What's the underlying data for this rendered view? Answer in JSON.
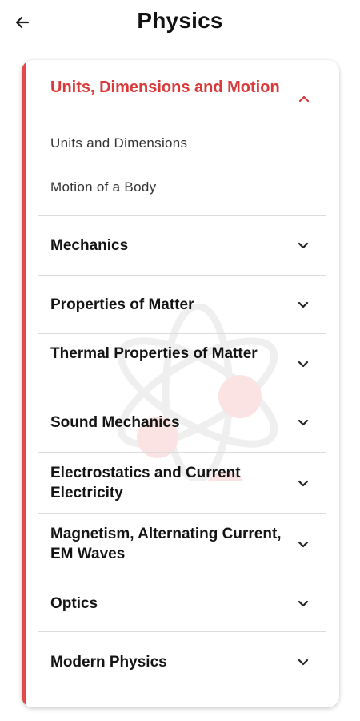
{
  "header": {
    "title": "Physics",
    "back_icon": "arrow-left-icon"
  },
  "colors": {
    "accent": "#d93a3a",
    "accent_bar": "#e24a4a",
    "divider": "#dcdcdc"
  },
  "expanded_section": {
    "title": "Units, Dimensions and Motion",
    "icon": "chevron-up-icon",
    "subitems": [
      "Units and Dimensions",
      "Motion of a Body"
    ]
  },
  "sections": [
    {
      "label": "Mechanics",
      "icon": "chevron-down-icon"
    },
    {
      "label": "Properties of Matter",
      "icon": "chevron-down-icon"
    },
    {
      "label": "Thermal Properties of Matter",
      "icon": "chevron-down-icon"
    },
    {
      "label": "Sound Mechanics",
      "icon": "chevron-down-icon"
    },
    {
      "label": "Electrostatics and Current Electricity",
      "icon": "chevron-down-icon"
    },
    {
      "label": "Magnetism, Alternating Current, EM Waves",
      "icon": "chevron-down-icon"
    },
    {
      "label": "Optics",
      "icon": "chevron-down-icon"
    },
    {
      "label": "Modern Physics",
      "icon": "chevron-down-icon"
    }
  ]
}
